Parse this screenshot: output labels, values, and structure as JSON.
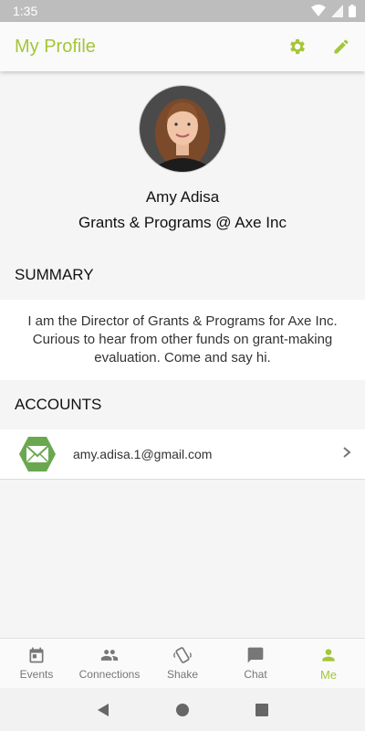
{
  "statusbar": {
    "time": "1:35"
  },
  "appbar": {
    "title": "My Profile"
  },
  "profile": {
    "name": "Amy Adisa",
    "headline": "Grants & Programs @ Axe Inc"
  },
  "summary": {
    "header": "SUMMARY",
    "text": "I am the Director of Grants & Programs for Axe Inc. Curious to hear from other funds on grant-making evaluation. Come and say hi."
  },
  "accounts": {
    "header": "ACCOUNTS",
    "items": [
      {
        "email": "amy.adisa.1@gmail.com"
      }
    ]
  },
  "bottom_nav": {
    "items": [
      {
        "label": "Events",
        "icon": "calendar-icon"
      },
      {
        "label": "Connections",
        "icon": "people-icon"
      },
      {
        "label": "Shake",
        "icon": "shake-phone-icon"
      },
      {
        "label": "Chat",
        "icon": "chat-bubble-icon"
      },
      {
        "label": "Me",
        "icon": "person-icon",
        "active": true
      }
    ]
  },
  "colors": {
    "accent": "#a4c639",
    "statusbar": "#bdbdbd",
    "icon_inactive": "#777777"
  }
}
